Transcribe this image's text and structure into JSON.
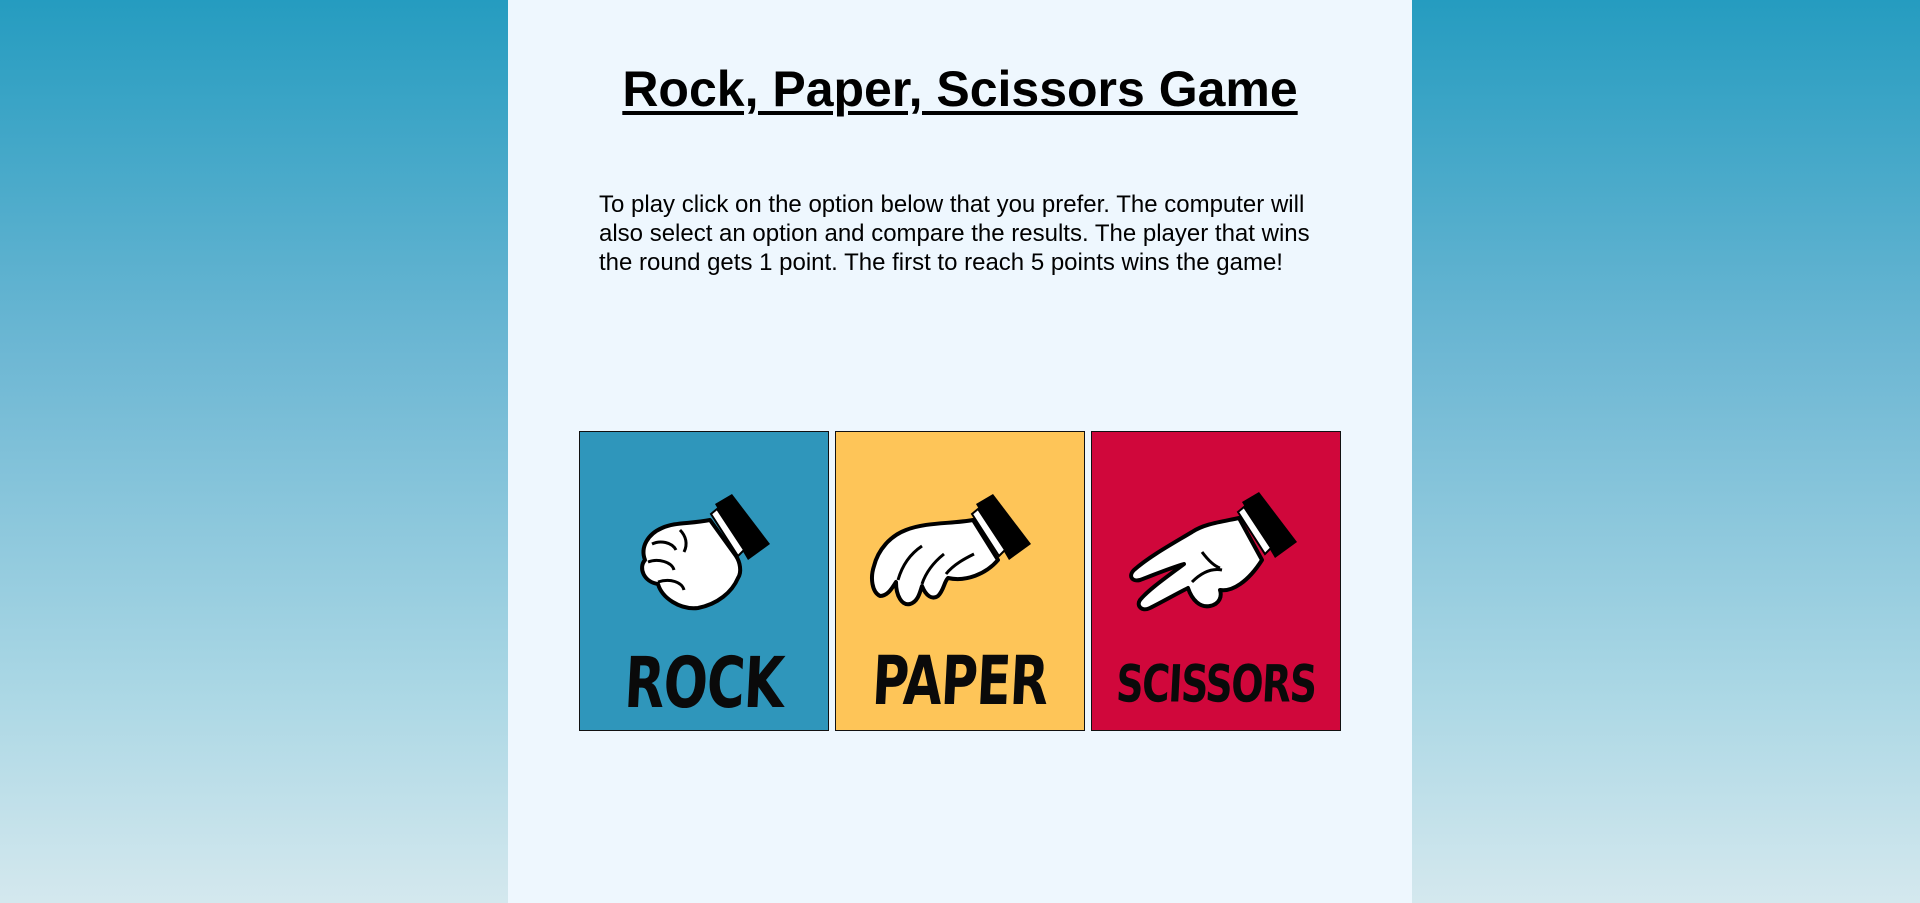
{
  "title": "Rock, Paper, Scissors Game",
  "instructions": "To play click on the option below that you prefer. The computer will also select an option and compare the results. The player that wins the round gets 1 point. The first to reach 5 points wins the game!",
  "options": [
    {
      "label": "ROCK",
      "icon": "rock-hand-icon",
      "color": "#2f96bb"
    },
    {
      "label": "PAPER",
      "icon": "paper-hand-icon",
      "color": "#fec558"
    },
    {
      "label": "SCISSORS",
      "icon": "scissors-hand-icon",
      "color": "#d0073b"
    }
  ]
}
